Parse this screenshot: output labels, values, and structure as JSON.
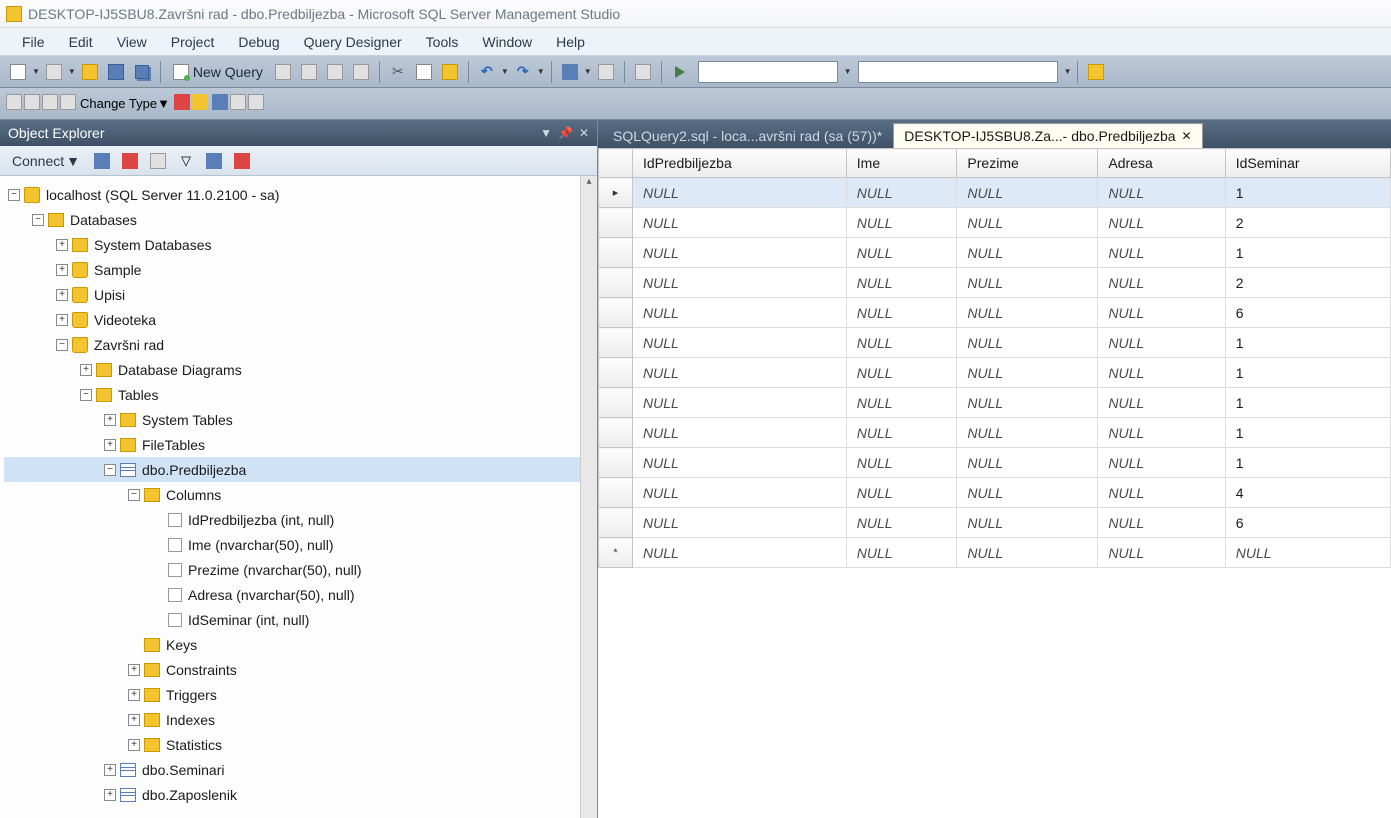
{
  "title": "DESKTOP-IJ5SBU8.Završni rad - dbo.Predbiljezba - Microsoft SQL Server Management Studio",
  "menu": [
    "File",
    "Edit",
    "View",
    "Project",
    "Debug",
    "Query Designer",
    "Tools",
    "Window",
    "Help"
  ],
  "toolbar": {
    "newQuery": "New Query",
    "changeType": "Change Type"
  },
  "objectExplorer": {
    "title": "Object Explorer",
    "connect": "Connect",
    "server": "localhost (SQL Server 11.0.2100 - sa)",
    "databases": "Databases",
    "sysdb": "System Databases",
    "dbs": [
      "Sample",
      "Upisi",
      "Videoteka",
      "Završni rad"
    ],
    "dbdiag": "Database Diagrams",
    "tables": "Tables",
    "systables": "System Tables",
    "filetables": "FileTables",
    "predb": "dbo.Predbiljezba",
    "columns": "Columns",
    "cols": [
      "IdPredbiljezba (int, null)",
      "Ime (nvarchar(50), null)",
      "Prezime (nvarchar(50), null)",
      "Adresa (nvarchar(50), null)",
      "IdSeminar (int, null)"
    ],
    "keys": "Keys",
    "constraints": "Constraints",
    "triggers": "Triggers",
    "indexes": "Indexes",
    "statistics": "Statistics",
    "seminari": "dbo.Seminari",
    "zaposlenik": "dbo.Zaposlenik"
  },
  "tabs": {
    "t1": "SQLQuery2.sql - loca...avršni rad (sa (57))*",
    "t2": "DESKTOP-IJ5SBU8.Za...- dbo.Predbiljezba"
  },
  "gridHeaders": [
    "IdPredbiljezba",
    "Ime",
    "Prezime",
    "Adresa",
    "IdSeminar"
  ],
  "gridRows": [
    {
      "id": "NULL",
      "ime": "NULL",
      "prezime": "NULL",
      "adresa": "NULL",
      "seminar": "1"
    },
    {
      "id": "NULL",
      "ime": "NULL",
      "prezime": "NULL",
      "adresa": "NULL",
      "seminar": "2"
    },
    {
      "id": "NULL",
      "ime": "NULL",
      "prezime": "NULL",
      "adresa": "NULL",
      "seminar": "1"
    },
    {
      "id": "NULL",
      "ime": "NULL",
      "prezime": "NULL",
      "adresa": "NULL",
      "seminar": "2"
    },
    {
      "id": "NULL",
      "ime": "NULL",
      "prezime": "NULL",
      "adresa": "NULL",
      "seminar": "6"
    },
    {
      "id": "NULL",
      "ime": "NULL",
      "prezime": "NULL",
      "adresa": "NULL",
      "seminar": "1"
    },
    {
      "id": "NULL",
      "ime": "NULL",
      "prezime": "NULL",
      "adresa": "NULL",
      "seminar": "1"
    },
    {
      "id": "NULL",
      "ime": "NULL",
      "prezime": "NULL",
      "adresa": "NULL",
      "seminar": "1"
    },
    {
      "id": "NULL",
      "ime": "NULL",
      "prezime": "NULL",
      "adresa": "NULL",
      "seminar": "1"
    },
    {
      "id": "NULL",
      "ime": "NULL",
      "prezime": "NULL",
      "adresa": "NULL",
      "seminar": "1"
    },
    {
      "id": "NULL",
      "ime": "NULL",
      "prezime": "NULL",
      "adresa": "NULL",
      "seminar": "4"
    },
    {
      "id": "NULL",
      "ime": "NULL",
      "prezime": "NULL",
      "adresa": "NULL",
      "seminar": "6"
    }
  ],
  "newRow": {
    "id": "NULL",
    "ime": "NULL",
    "prezime": "NULL",
    "adresa": "NULL",
    "seminar": "NULL"
  }
}
